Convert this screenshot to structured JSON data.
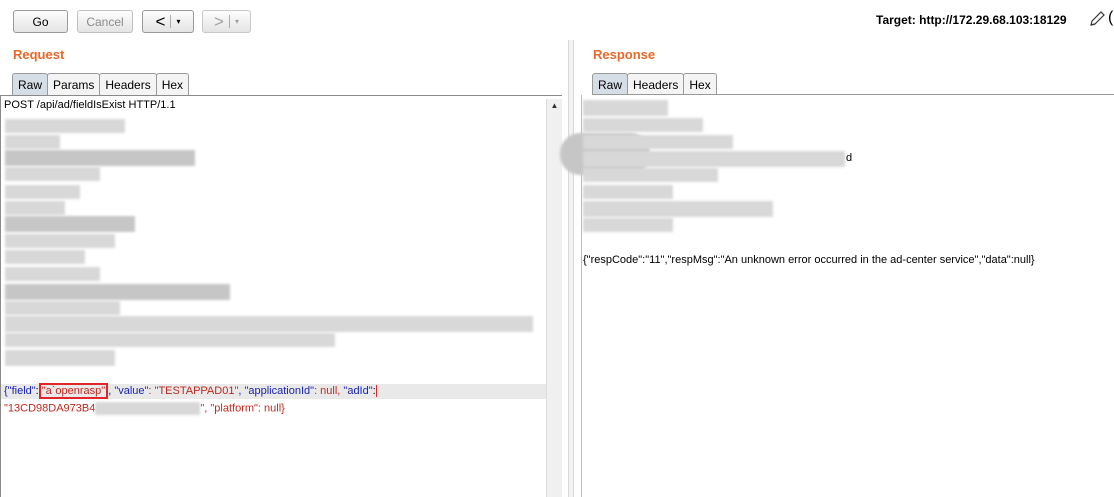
{
  "toolbar": {
    "go_label": "Go",
    "cancel_label": "Cancel",
    "back_glyph": "<",
    "forward_glyph": ">",
    "dropdown_glyph": "▾",
    "target_label": "Target: http://172.29.68.103:18129"
  },
  "request": {
    "title": "Request",
    "tabs": [
      "Raw",
      "Params",
      "Headers",
      "Hex"
    ],
    "active_tab": "Raw",
    "first_line": "POST /api/ad/fieldIsExist HTTP/1.1",
    "body_line1": {
      "k_field": "{\"field\"",
      "colon1": ":",
      "v_field": "\"a`openrasp\"",
      "k_value": ", \"value\"",
      "v_value": ": \"TESTAPPAD01\"",
      "k_app": ", \"applicationId\"",
      "v_app": ": null, ",
      "k_adid": "\"adId\"",
      "colon2": ":"
    },
    "body_line2": {
      "v_adid": "\"13CD98DA973B4",
      "tail_key": "\", \"platform\"",
      "tail_val": ": null}"
    }
  },
  "response": {
    "title": "Response",
    "tabs": [
      "Raw",
      "Headers",
      "Hex"
    ],
    "active_tab": "Raw",
    "partial_char": "d",
    "body": "{\"respCode\":\"11\",\"respMsg\":\"An unknown error occurred in the ad-center service\",\"data\":null}"
  },
  "icons": {
    "edit": "pencil-icon",
    "scroll": "scroll-up-arrow-icon"
  },
  "colors": {
    "title": "#e8692a",
    "json_key": "#1a23b5",
    "json_string": "#c0281e",
    "highlight_box": "#e0262a"
  }
}
